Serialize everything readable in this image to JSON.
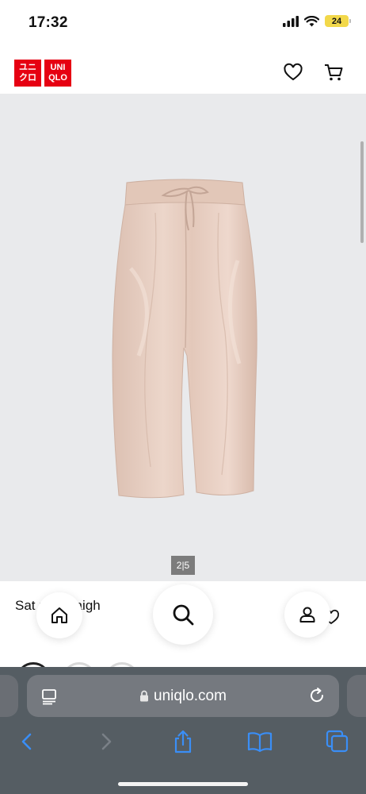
{
  "status_bar": {
    "time": "17:32",
    "battery": "24"
  },
  "header": {
    "logo_top": "ユニ\nクロ",
    "logo_bottom": "UNI\nQLO",
    "wishlist_icon": "heart-outline-icon",
    "cart_icon": "cart-icon"
  },
  "product": {
    "image_alt": "beige satin straight pants",
    "image_counter": "2|5",
    "title": "Sat  pe Straigh"
  },
  "floating_nav": {
    "home_icon": "home-icon",
    "search_icon": "search-icon",
    "account_icon": "account-icon"
  },
  "browser": {
    "url": "uniqlo.com",
    "toolbar": [
      "back",
      "forward",
      "share",
      "bookmarks",
      "tabs"
    ]
  },
  "colors": {
    "brand_red": "#e60012",
    "product_color": "#e8cfc2",
    "image_background": "#e9eaec",
    "browser_accent": "#3a8ef6"
  }
}
